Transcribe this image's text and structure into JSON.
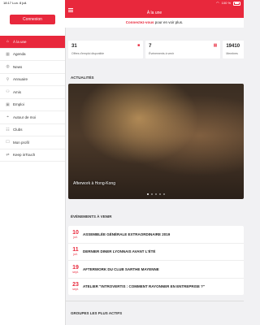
{
  "status_bar": {
    "time": "18:17  Lun. 8 juil.",
    "battery": "100 %"
  },
  "sidebar": {
    "connect_label": "Connexion",
    "items": [
      {
        "label": "À la une",
        "icon": "home-icon",
        "active": true
      },
      {
        "label": "Agenda",
        "icon": "calendar-icon"
      },
      {
        "label": "News",
        "icon": "globe-icon"
      },
      {
        "label": "Annuaire",
        "icon": "search-icon"
      },
      {
        "label": "Amis",
        "icon": "friends-icon"
      },
      {
        "label": "Emploi",
        "icon": "briefcase-icon"
      },
      {
        "label": "Autour de moi",
        "icon": "map-pin-icon"
      },
      {
        "label": "Clubs",
        "icon": "clubs-icon"
      },
      {
        "label": "Mon profil",
        "icon": "profile-icon"
      },
      {
        "label": "Keep inTouch",
        "icon": "keep-in-touch-icon"
      }
    ]
  },
  "header": {
    "title": "À la une"
  },
  "banner": {
    "link": "Connectez-vous",
    "text": " pour en voir plus."
  },
  "stats": [
    {
      "value": "31",
      "label": "Offres d'emploi disponible"
    },
    {
      "value": "7",
      "label": "Événements à venir"
    },
    {
      "value": "19410",
      "label": "Membres"
    }
  ],
  "actualites": {
    "title": "ACTUALITÉS",
    "caption": "Afterwork à Hong-Kong"
  },
  "events": {
    "title": "ÉVÉNEMENTS À VENIR",
    "items": [
      {
        "day": "10",
        "month": "juil.",
        "name": "ASSEMBLÉE GÉNÉRALE EXTRAORDINAIRE 2019"
      },
      {
        "day": "11",
        "month": "juil.",
        "name": "DERNIER DINER LYONNAIS AVANT L'ÉTÉ"
      },
      {
        "day": "19",
        "month": "sept.",
        "name": "AFTERWORK DU CLUB SARTHE MAYENNE"
      },
      {
        "day": "23",
        "month": "sept.",
        "name": "ATELIER \"INTROVERTIS : COMMENT RAYONNER EN ENTREPRISE ?\""
      }
    ]
  },
  "groups": {
    "title": "GROUPES LES PLUS ACTIFS"
  },
  "colors": {
    "accent": "#e8283c"
  }
}
